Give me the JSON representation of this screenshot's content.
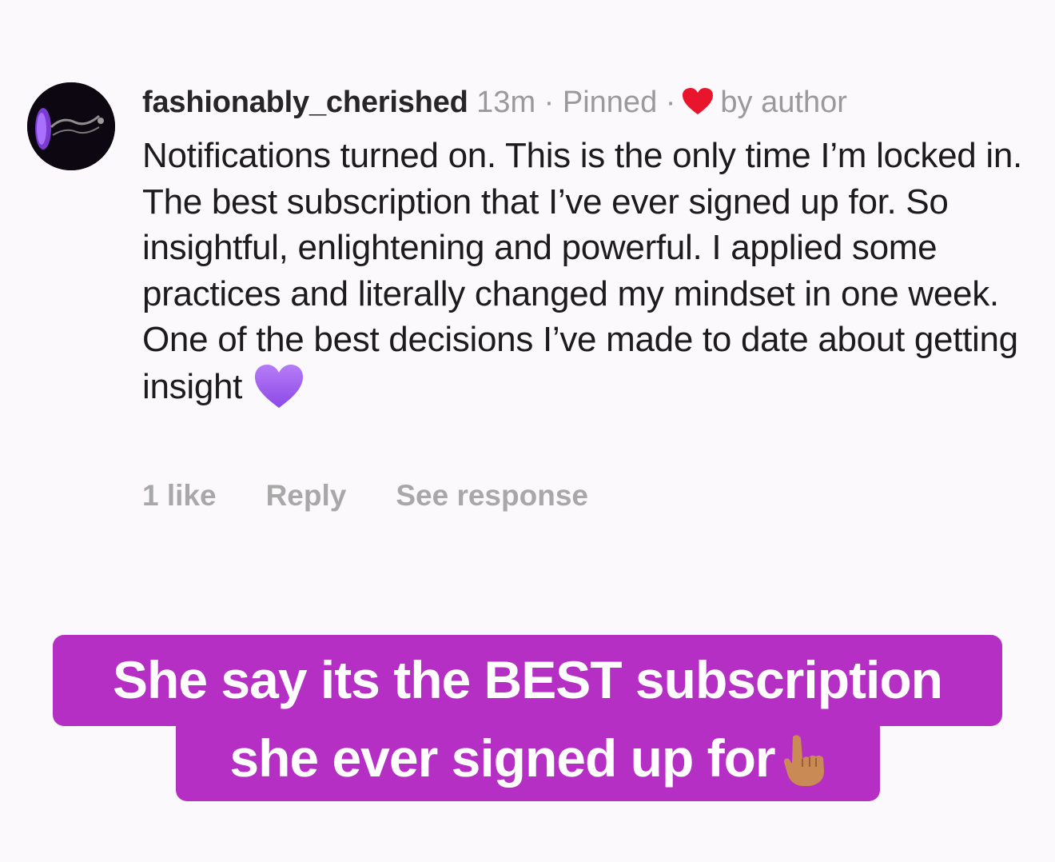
{
  "comment": {
    "username": "fashionably_cherished",
    "time": "13m",
    "separator": "·",
    "pinned": "Pinned",
    "liked_by": "by author",
    "body": "Notifications turned on. This is the only time I’m locked in. The best subscription that I’ve ever signed up for. So insightful, enlightening and powerful. I applied some practices and literally changed my mindset in one week. One of the best decisions I’ve made to date about getting insight",
    "actions": {
      "likes": "1 like",
      "reply": "Reply",
      "see_response": "See response"
    }
  },
  "caption": {
    "line1": "She say its the BEST subscription",
    "line2": "she ever signed up for"
  },
  "icons": {
    "avatar": "avatar-logo",
    "heart": "red-heart-icon",
    "body_emoji": "purple-heart-icon",
    "caption_emoji": "pointing-up-icon"
  },
  "colors": {
    "background": "#fbf9fc",
    "banner": "#b62fc4",
    "heart": "#e8152c",
    "purple_heart": "#a35ef0",
    "meta_text": "#9a9a9a"
  }
}
